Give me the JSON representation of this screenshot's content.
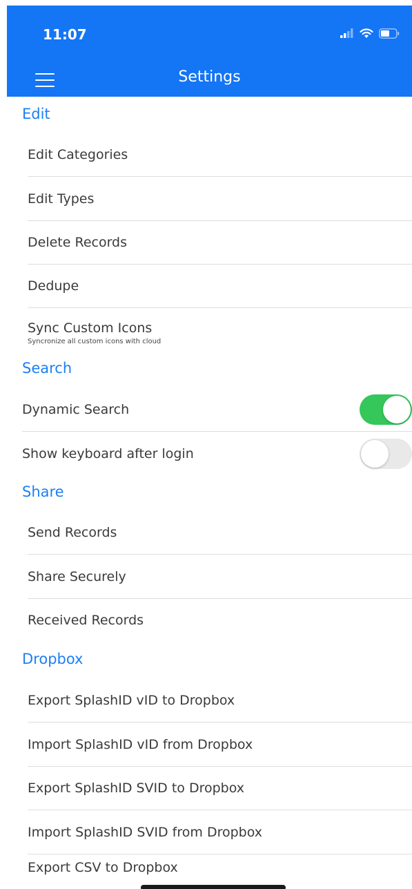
{
  "status_bar": {
    "time": "11:07",
    "icons": [
      "signal-icon",
      "wifi-icon",
      "battery-icon"
    ]
  },
  "nav": {
    "title": "Settings",
    "menu_icon": "hamburger-menu-icon",
    "background_color": "#1475f5"
  },
  "sections": {
    "edit": {
      "header": "Edit",
      "items": [
        {
          "label": "Edit Categories"
        },
        {
          "label": "Edit Types"
        },
        {
          "label": "Delete Records"
        },
        {
          "label": "Dedupe"
        },
        {
          "label": "Sync Custom Icons",
          "subtitle": "Syncronize all custom icons with cloud"
        }
      ]
    },
    "search": {
      "header": "Search",
      "items": [
        {
          "label": "Dynamic Search",
          "toggle": true
        },
        {
          "label": "Show keyboard after login",
          "toggle": false
        }
      ]
    },
    "share": {
      "header": "Share",
      "items": [
        {
          "label": "Send Records"
        },
        {
          "label": "Share Securely"
        },
        {
          "label": "Received Records"
        }
      ]
    },
    "dropbox": {
      "header": "Dropbox",
      "items": [
        {
          "label": "Export SplashID vID to Dropbox"
        },
        {
          "label": "Import SplashID vID from Dropbox"
        },
        {
          "label": "Export SplashID SVID to Dropbox"
        },
        {
          "label": "Import SplashID SVID from Dropbox"
        },
        {
          "label": "Export CSV to Dropbox"
        }
      ]
    }
  },
  "colors": {
    "accent": "#1c7ff6",
    "toggle_on": "#35c759",
    "toggle_off": "#e9e9ea"
  }
}
